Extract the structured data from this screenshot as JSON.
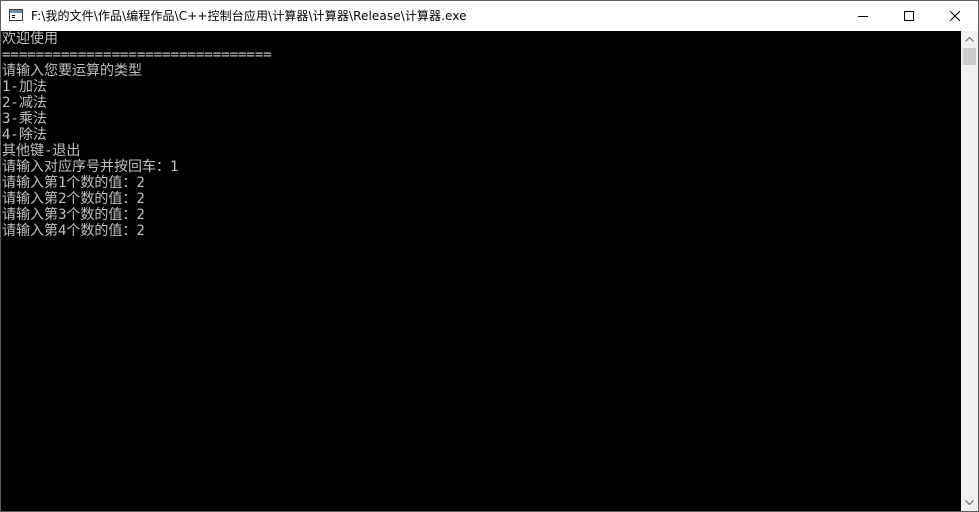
{
  "window": {
    "title": "F:\\我的文件\\作品\\编程作品\\C++控制台应用\\计算器\\计算器\\Release\\计算器.exe",
    "app_icon": "console-app-icon",
    "controls": {
      "minimize_icon": "minimize-icon",
      "maximize_icon": "maximize-icon",
      "close_icon": "close-icon"
    }
  },
  "console": {
    "background": "#000000",
    "foreground": "#c0c0c0",
    "lines": [
      "欢迎使用",
      "================================",
      "请输入您要运算的类型",
      "1-加法",
      "2-减法",
      "3-乘法",
      "4-除法",
      "其他键-退出",
      "请输入对应序号并按回车：1",
      "请输入第1个数的值：2",
      "请输入第2个数的值：2",
      "请输入第3个数的值：2",
      "请输入第4个数的值：2"
    ]
  },
  "scrollbar": {
    "up_icon": "scroll-up-arrow-icon",
    "down_icon": "scroll-down-arrow-icon"
  }
}
